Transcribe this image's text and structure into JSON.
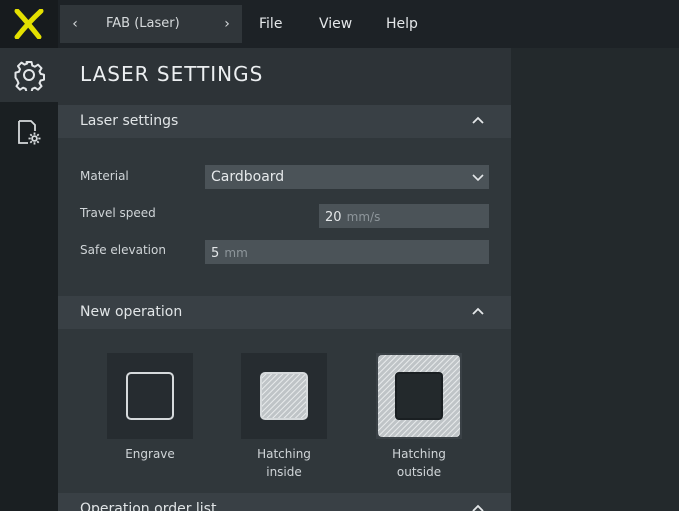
{
  "topbar": {
    "breadcrumb_label": "FAB (Laser)",
    "menu": [
      "File",
      "View",
      "Help"
    ]
  },
  "panel": {
    "title": "LASER SETTINGS",
    "laser_settings": {
      "header": "Laser settings",
      "material_label": "Material",
      "material_value": "Cardboard",
      "travel_speed_label": "Travel speed",
      "travel_speed_value": "20",
      "travel_speed_unit": "mm/s",
      "safe_elevation_label": "Safe elevation",
      "safe_elevation_value": "5",
      "safe_elevation_unit": "mm"
    },
    "new_operation": {
      "header": "New operation",
      "ops": [
        "Engrave",
        "Hatching inside",
        "Hatching outside"
      ]
    },
    "order_list": {
      "header": "Operation order list"
    }
  },
  "colors": {
    "accent": "#e4e000",
    "background": "#2a2f33",
    "panel": "#2d3337",
    "section_header": "#394045"
  },
  "icons": [
    "logo-x-icon",
    "chevron-left-icon",
    "chevron-right-icon",
    "gear-icon",
    "file-settings-icon",
    "chevron-up-icon",
    "chevron-down-icon"
  ]
}
